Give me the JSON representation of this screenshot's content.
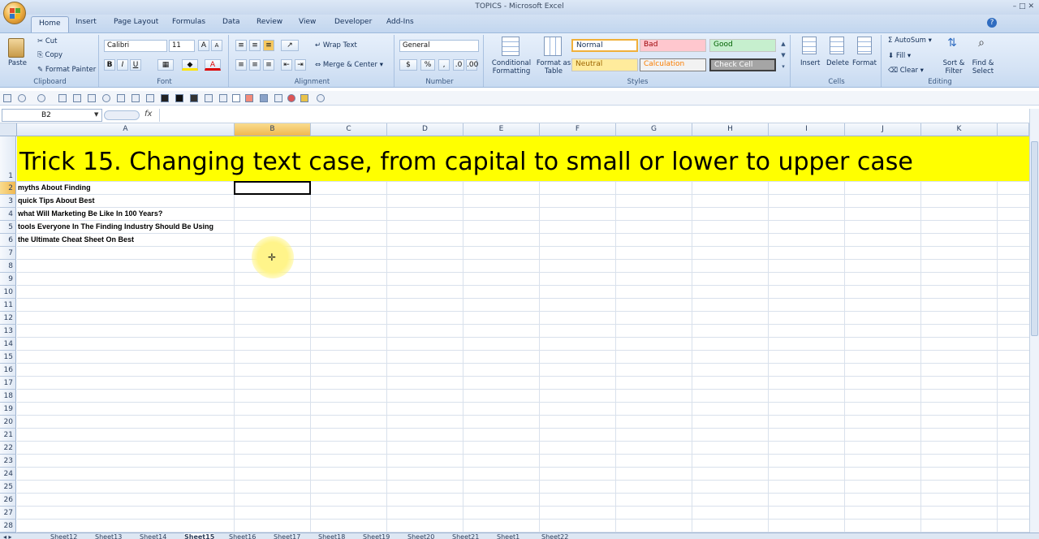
{
  "window_title": "TOPICS - Microsoft Excel",
  "ribbon_tabs": [
    "Home",
    "Insert",
    "Page Layout",
    "Formulas",
    "Data",
    "Review",
    "View",
    "Developer",
    "Add-Ins"
  ],
  "active_tab": "Home",
  "clipboard": {
    "paste": "Paste",
    "cut": "Cut",
    "copy": "Copy",
    "format_painter": "Format Painter",
    "label": "Clipboard"
  },
  "font": {
    "name": "Calibri",
    "size": "11",
    "label": "Font",
    "bold": "B",
    "italic": "I",
    "underline": "U"
  },
  "alignment": {
    "wrap": "Wrap Text",
    "merge": "Merge & Center",
    "label": "Alignment"
  },
  "number": {
    "format": "General",
    "currency": "$",
    "percent": "%",
    "comma": ",",
    "label": "Number"
  },
  "styles": {
    "conditional": "Conditional Formatting",
    "format_table": "Format as Table",
    "normal": "Normal",
    "bad": "Bad",
    "good": "Good",
    "neutral": "Neutral",
    "calculation": "Calculation",
    "check_cell": "Check Cell",
    "label": "Styles"
  },
  "cells_group": {
    "insert": "Insert",
    "delete": "Delete",
    "format": "Format",
    "label": "Cells"
  },
  "editing": {
    "autosum": "AutoSum",
    "fill": "Fill",
    "clear": "Clear",
    "sort": "Sort & Filter",
    "find": "Find & Select",
    "label": "Editing"
  },
  "formula_bar": {
    "name_box": "B2",
    "fx": "fx",
    "content": ""
  },
  "columns": [
    "A",
    "B",
    "C",
    "D",
    "E",
    "F",
    "G",
    "H",
    "I",
    "J",
    "K"
  ],
  "selected_column": "B",
  "selected_row": "2",
  "rows": [
    "1",
    "2",
    "3",
    "4",
    "5",
    "6",
    "7",
    "8",
    "9",
    "10",
    "11",
    "12",
    "13",
    "14",
    "15",
    "16",
    "17",
    "18",
    "19",
    "20",
    "21",
    "22",
    "23",
    "24",
    "25",
    "26",
    "27",
    "28"
  ],
  "headline": "Trick 15. Changing text case, from capital to small or lower to upper case",
  "cells": [
    "myths About Finding",
    "quick Tips About Best",
    "what Will Marketing Be Like In 100 Years?",
    "tools Everyone In The Finding Industry Should Be Using",
    "the Ultimate Cheat Sheet On Best"
  ],
  "sheets": [
    "Sheet12",
    "Sheet13",
    "Sheet14",
    "Sheet15",
    "Sheet16",
    "Sheet17",
    "Sheet18",
    "Sheet19",
    "Sheet20",
    "Sheet21",
    "Sheet1",
    "Sheet22"
  ],
  "active_sheet": "Sheet15",
  "colors": {
    "headline_fill": "#ffff00",
    "ribbon": "#d5e3f5",
    "selection_header": "#f0b850"
  }
}
